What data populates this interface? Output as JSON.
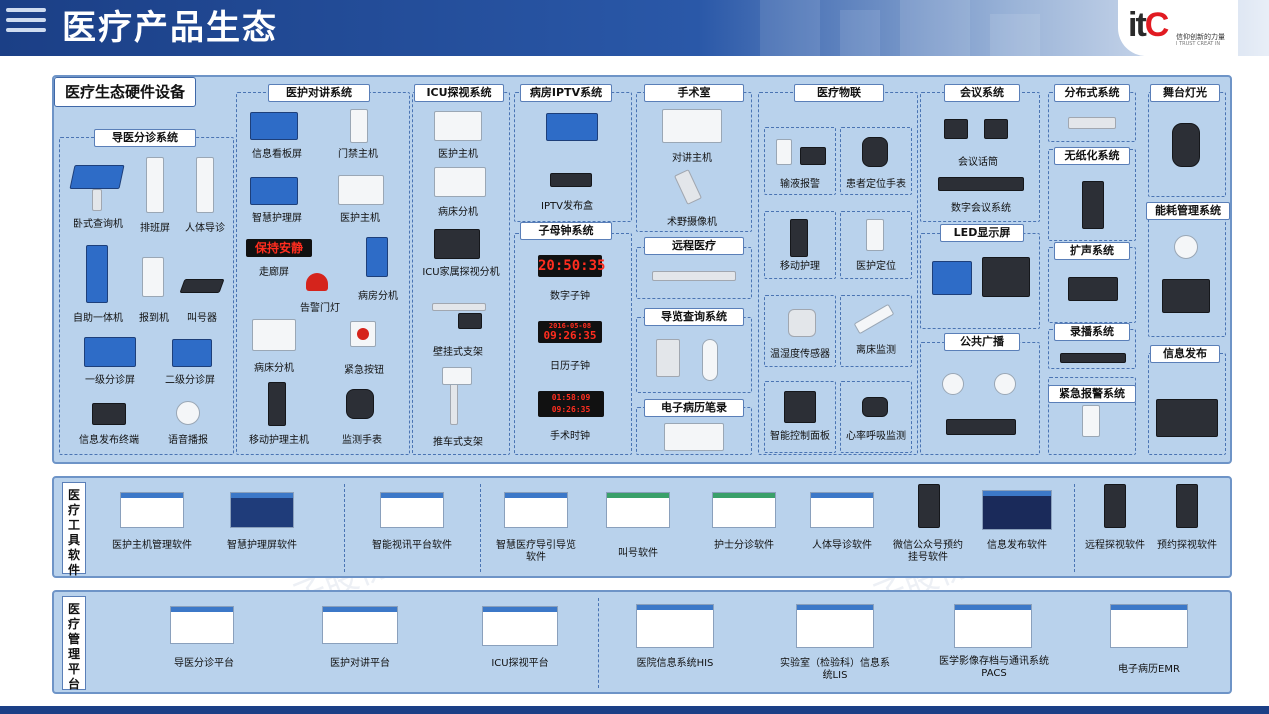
{
  "header": {
    "title": "医疗产品生态",
    "logo_text": "itC",
    "slogan": "信仰创新的力量",
    "slogan_en": "I TRUST CREAT IN"
  },
  "watermark": "广东保伦电子股份有限公司",
  "hardware": {
    "title": "医疗生态硬件设备",
    "groups": {
      "guide": {
        "name": "导医分诊系统",
        "items": [
          "卧式查询机",
          "排班屏",
          "人体导诊",
          "自助一体机",
          "报到机",
          "叫号器",
          "一级分诊屏",
          "二级分诊屏",
          "信息发布终端",
          "语音播报"
        ]
      },
      "intercom": {
        "name": "医护对讲系统",
        "items": [
          "信息看板屏",
          "门禁主机",
          "智慧护理屏",
          "医护主机",
          "走廊屏",
          "告警门灯",
          "病房分机",
          "病床分机",
          "紧急按钮",
          "移动护理主机",
          "监测手表"
        ]
      },
      "icu": {
        "name": "ICU探视系统",
        "items": [
          "医护主机",
          "病床分机",
          "ICU家属探视分机",
          "壁挂式支架",
          "推车式支架"
        ]
      },
      "iptv": {
        "name": "病房IPTV系统",
        "items": [
          "IPTV发布盒"
        ]
      },
      "clock": {
        "name": "子母钟系统",
        "items": [
          "数字子钟",
          "日历子钟",
          "手术时钟"
        ],
        "digital": "20:50:35",
        "calendar_date": "2016-05-08",
        "calendar_time": "09:26:35",
        "surgery_a": "01:58:09",
        "surgery_b": "09:26:35"
      },
      "surgery": {
        "name": "手术室",
        "items": [
          "对讲主机",
          "术野摄像机"
        ]
      },
      "remote": {
        "name": "远程医疗"
      },
      "nav": {
        "name": "导览查询系统"
      },
      "emr": {
        "name": "电子病历笔录"
      },
      "iot": {
        "name": "医疗物联",
        "items": [
          "输液报警",
          "患者定位手表",
          "移动护理",
          "医护定位",
          "温湿度传感器",
          "离床监测",
          "智能控制面板",
          "心率呼吸监测"
        ]
      },
      "meeting": {
        "name": "会议系统",
        "items": [
          "会议话筒",
          "数字会议系统"
        ]
      },
      "ledscreen": {
        "name": "LED显示屏"
      },
      "pa": {
        "name": "公共广播"
      },
      "distributed": {
        "name": "分布式系统"
      },
      "paperless": {
        "name": "无纸化系统"
      },
      "sound": {
        "name": "扩声系统"
      },
      "recording": {
        "name": "录播系统"
      },
      "alarm": {
        "name": "紧急报警系统"
      },
      "stage": {
        "name": "舞台灯光"
      },
      "energy": {
        "name": "能耗管理系统"
      },
      "info": {
        "name": "信息发布"
      }
    }
  },
  "software": {
    "title": "医疗工具软件",
    "items": [
      "医护主机管理软件",
      "智慧护理屏软件",
      "智能视讯平台软件",
      "智慧医疗导引导览软件",
      "叫号软件",
      "护士分诊软件",
      "人体导诊软件",
      "微信公众号预约挂号软件",
      "信息发布软件",
      "远程探视软件",
      "预约探视软件"
    ]
  },
  "platform": {
    "title": "医疗管理平台",
    "items": [
      "导医分诊平台",
      "医护对讲平台",
      "ICU探视平台",
      "医院信息系统HIS",
      "实验室（检验科）信息系统LIS",
      "医学影像存档与通讯系统PACS",
      "电子病历EMR"
    ]
  }
}
